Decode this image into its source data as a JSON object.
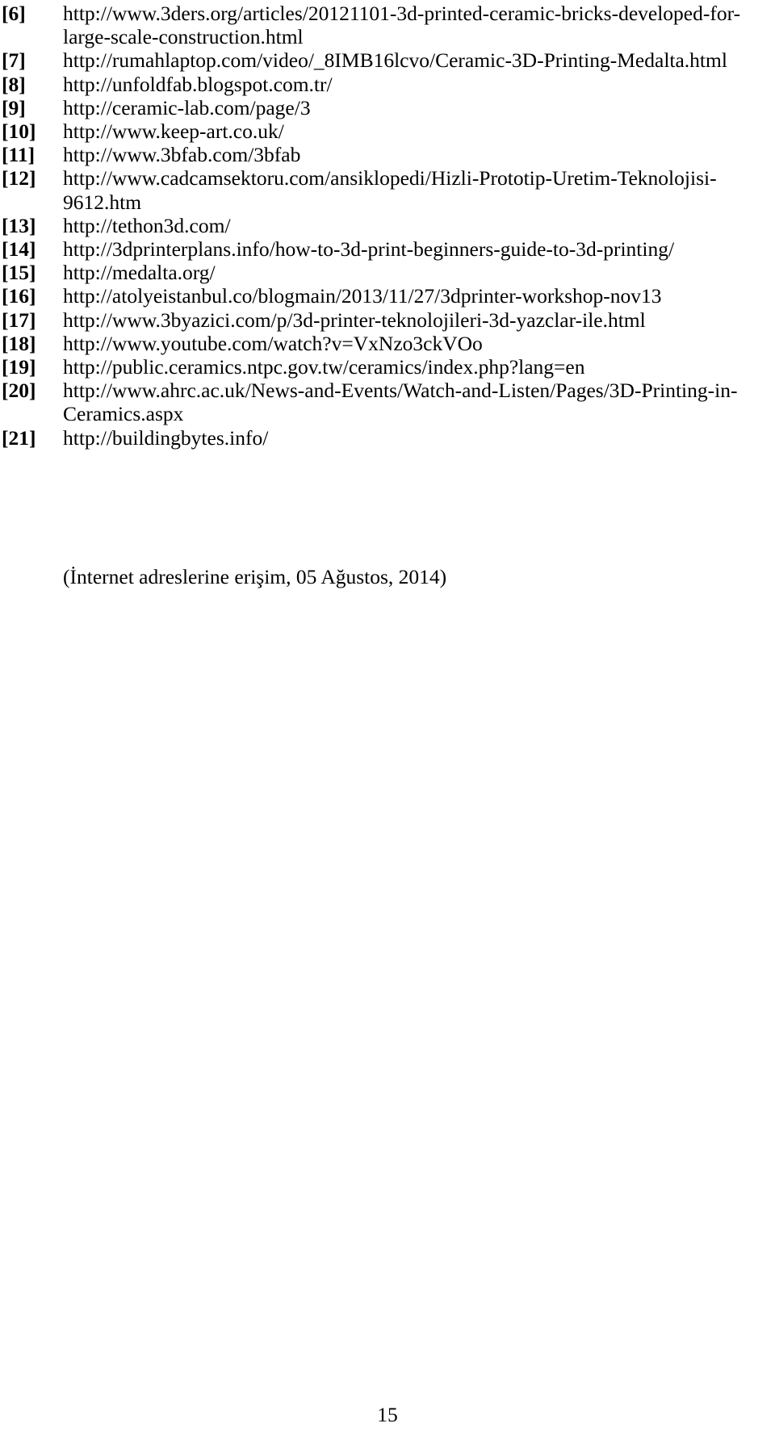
{
  "document": {
    "page_number": "15",
    "access_note": "(İnternet adreslerine erişim, 05 Ağustos, 2014)",
    "references": [
      {
        "label": "[6]",
        "url": "http://www.3ders.org/articles/20121101-3d-printed-ceramic-bricks-developed-for-large-scale-construction.html"
      },
      {
        "label": "[7]",
        "url": "http://rumahlaptop.com/video/_8IMB16lcvo/Ceramic-3D-Printing-Medalta.html"
      },
      {
        "label": "[8]",
        "url": "http://unfoldfab.blogspot.com.tr/"
      },
      {
        "label": "[9]",
        "url": "http://ceramic-lab.com/page/3"
      },
      {
        "label": "[10]",
        "url": "http://www.keep-art.co.uk/"
      },
      {
        "label": "[11]",
        "url": "http://www.3bfab.com/3bfab"
      },
      {
        "label": "[12]",
        "url": "http://www.cadcamsektoru.com/ansiklopedi/Hizli-Prototip-Uretim-Teknolojisi-9612.htm"
      },
      {
        "label": "[13]",
        "url": "http://tethon3d.com/"
      },
      {
        "label": "[14]",
        "url": "http://3dprinterplans.info/how-to-3d-print-beginners-guide-to-3d-printing/"
      },
      {
        "label": "[15]",
        "url": "http://medalta.org/"
      },
      {
        "label": "[16]",
        "url": "http://atolyeistanbul.co/blogmain/2013/11/27/3dprinter-workshop-nov13"
      },
      {
        "label": "[17]",
        "url": "http://www.3byazici.com/p/3d-printer-teknolojileri-3d-yazclar-ile.html"
      },
      {
        "label": "[18]",
        "url": "http://www.youtube.com/watch?v=VxNzo3ckVOo"
      },
      {
        "label": "[19]",
        "url": "http://public.ceramics.ntpc.gov.tw/ceramics/index.php?lang=en"
      },
      {
        "label": "[20]",
        "url": "http://www.ahrc.ac.uk/News-and-Events/Watch-and-Listen/Pages/3D-Printing-in-Ceramics.aspx"
      },
      {
        "label": "[21]",
        "url": "http://buildingbytes.info/"
      }
    ]
  }
}
